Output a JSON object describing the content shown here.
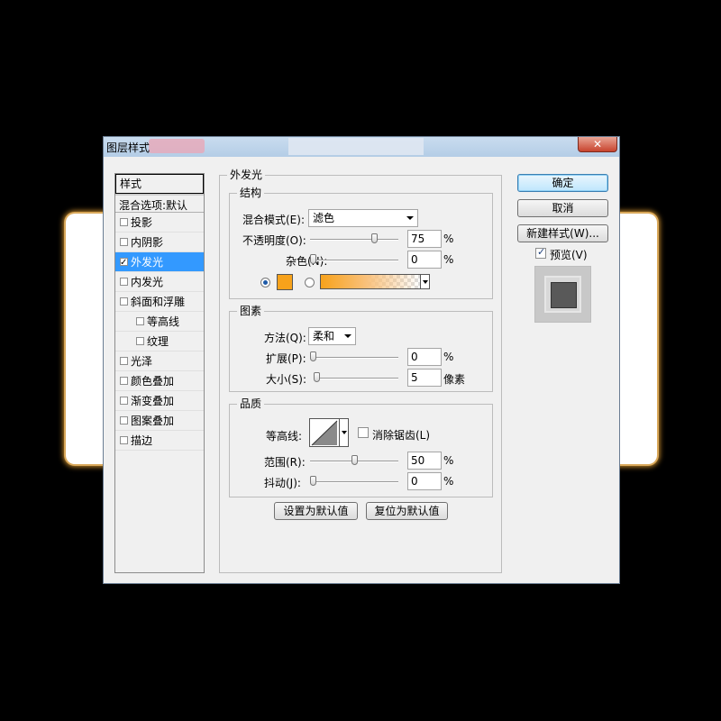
{
  "window": {
    "title": "图层样式",
    "close_label": "✕"
  },
  "style_list": {
    "header": "样式",
    "blend_options": "混合选项:默认",
    "items": [
      {
        "label": "投影",
        "checked": false,
        "indent": false
      },
      {
        "label": "内阴影",
        "checked": false,
        "indent": false
      },
      {
        "label": "外发光",
        "checked": true,
        "indent": false,
        "selected": true
      },
      {
        "label": "内发光",
        "checked": false,
        "indent": false
      },
      {
        "label": "斜面和浮雕",
        "checked": false,
        "indent": false
      },
      {
        "label": "等高线",
        "checked": false,
        "indent": true
      },
      {
        "label": "纹理",
        "checked": false,
        "indent": true
      },
      {
        "label": "光泽",
        "checked": false,
        "indent": false
      },
      {
        "label": "颜色叠加",
        "checked": false,
        "indent": false
      },
      {
        "label": "渐变叠加",
        "checked": false,
        "indent": false
      },
      {
        "label": "图案叠加",
        "checked": false,
        "indent": false
      },
      {
        "label": "描边",
        "checked": false,
        "indent": false
      }
    ]
  },
  "outer_glow": {
    "title": "外发光",
    "structure": {
      "title": "结构",
      "blend_mode_label": "混合模式(E):",
      "blend_mode_value": "滤色",
      "opacity_label": "不透明度(O):",
      "opacity_value": "75",
      "opacity_fraction": 0.75,
      "opacity_unit": "%",
      "noise_label": "杂色(N):",
      "noise_value": "0",
      "noise_unit": "%",
      "color": "#f7a21b",
      "color_mode": "solid"
    },
    "elements": {
      "title": "图素",
      "method_label": "方法(Q):",
      "method_value": "柔和",
      "spread_label": "扩展(P):",
      "spread_value": "0",
      "spread_unit": "%",
      "size_label": "大小(S):",
      "size_value": "5",
      "size_unit": "像素"
    },
    "quality": {
      "title": "品质",
      "contour_label": "等高线:",
      "antialias_label": "消除锯齿(L)",
      "antialias_checked": false,
      "range_label": "范围(R):",
      "range_value": "50",
      "range_fraction": 0.5,
      "range_unit": "%",
      "jitter_label": "抖动(J):",
      "jitter_value": "0",
      "jitter_unit": "%"
    },
    "set_default": "设置为默认值",
    "reset_default": "复位为默认值"
  },
  "buttons": {
    "ok": "确定",
    "cancel": "取消",
    "new_style": "新建样式(W)...",
    "preview_label": "预览(V)",
    "preview_checked": true
  }
}
